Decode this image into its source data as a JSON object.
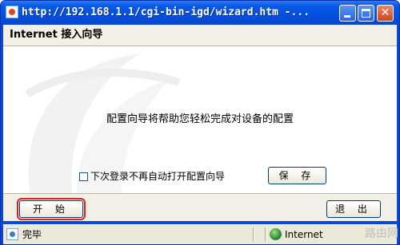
{
  "window": {
    "title": "http://192.168.1.1/cgi-bin-igd/wizard.htm -...",
    "controls": [
      "minimize",
      "maximize",
      "close"
    ]
  },
  "dialog": {
    "heading": "Internet 接入向导",
    "message": "配置向导将帮助您轻松完成对设备的配置",
    "checkbox_label": "下次登录不再自动打开配置向导",
    "checkbox_checked": false,
    "save_label": "保 存",
    "start_label": "开 始",
    "exit_label": "退 出"
  },
  "statusbar": {
    "status_text": "完毕",
    "zone_text": "Internet"
  },
  "watermark_text": "路由网",
  "icons": {
    "app": "ie-page-icon",
    "status": "page-done-icon",
    "zone": "internet-globe-icon"
  },
  "colors": {
    "titlebar": "#0550df",
    "highlight_outline": "#e02020",
    "panel": "#f1efe6"
  }
}
